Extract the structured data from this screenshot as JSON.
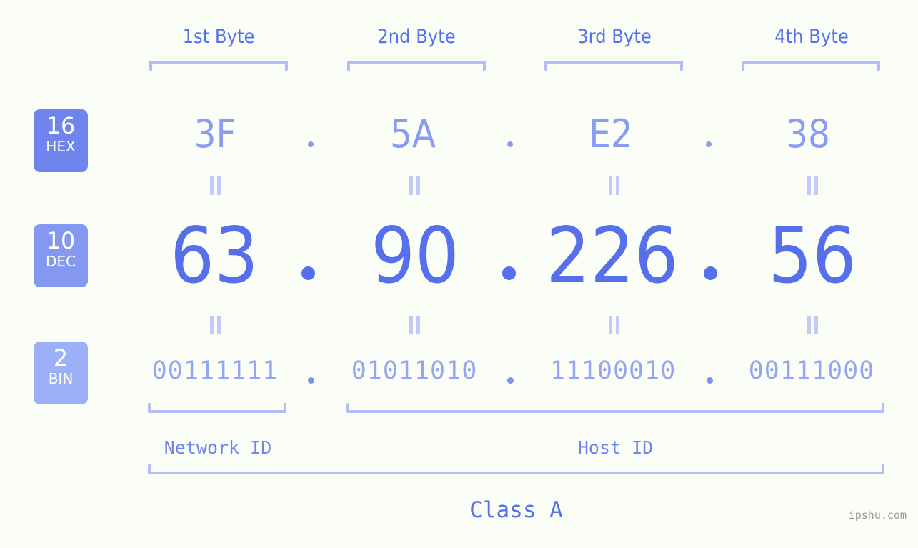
{
  "page": {
    "background_color": "#fbfdf7",
    "watermark": "ipshu.com"
  },
  "byte_headers": [
    {
      "label": "1st Byte"
    },
    {
      "label": "2nd Byte"
    },
    {
      "label": "3rd Byte"
    },
    {
      "label": "4th Byte"
    }
  ],
  "bases": {
    "hex": {
      "number": "16",
      "name": "HEX",
      "color": "#7084ee",
      "text_color": "#8a9cf2"
    },
    "dec": {
      "number": "10",
      "name": "DEC",
      "color": "#8498f2",
      "text_color": "#5570ea"
    },
    "bin": {
      "number": "2",
      "name": "BIN",
      "color": "#9cb0f7",
      "text_color": "#93a5f3"
    }
  },
  "separator": ".",
  "equals_mark": "=",
  "rows": {
    "hex": [
      "3F",
      "5A",
      "E2",
      "38"
    ],
    "dec": [
      "63",
      "90",
      "226",
      "56"
    ],
    "bin": [
      "00111111",
      "01011010",
      "11100010",
      "00111000"
    ]
  },
  "segments": {
    "network_id": "Network ID",
    "host_id": "Host ID"
  },
  "class": "Class A",
  "address": {
    "hex": "3F.5A.E2.38",
    "dec": "63.90.226.56",
    "bin": "00111111.01011010.11100010.00111000"
  }
}
